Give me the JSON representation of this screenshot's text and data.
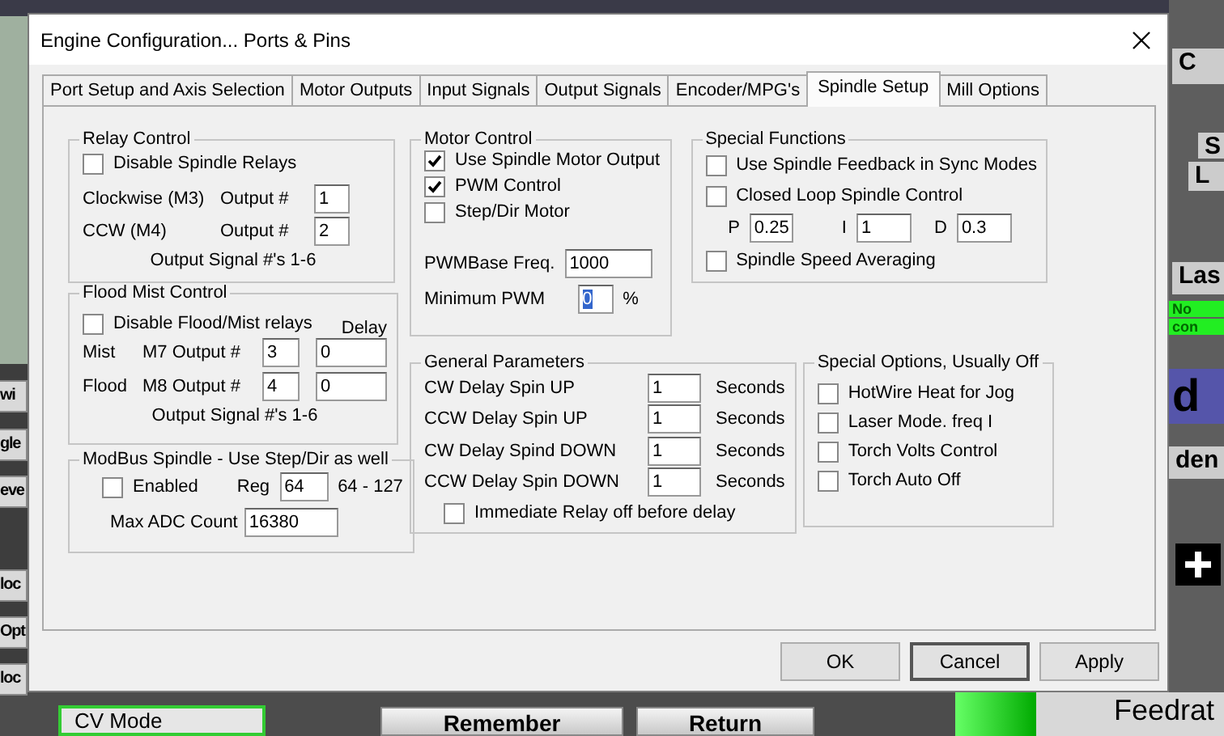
{
  "background": {
    "fragments": [
      {
        "text": "wi"
      },
      {
        "text": "gle"
      },
      {
        "text": "eve"
      },
      {
        "text": "loc"
      },
      {
        "text": "Opt"
      },
      {
        "text": "loc"
      },
      {
        "text": "CV Mode"
      },
      {
        "text": "Remember"
      },
      {
        "text": "Return"
      },
      {
        "text": "Feedrat"
      },
      {
        "text": "C"
      },
      {
        "text": "S"
      },
      {
        "text": "L"
      },
      {
        "text": "Las"
      },
      {
        "text": "No"
      },
      {
        "text": "con"
      },
      {
        "text": "d"
      },
      {
        "text": "den"
      }
    ]
  },
  "window": {
    "title": "Engine Configuration... Ports & Pins"
  },
  "tabs": [
    {
      "label": "Port Setup and Axis Selection",
      "selected": false
    },
    {
      "label": "Motor Outputs",
      "selected": false
    },
    {
      "label": "Input Signals",
      "selected": false
    },
    {
      "label": "Output Signals",
      "selected": false
    },
    {
      "label": "Encoder/MPG's",
      "selected": false
    },
    {
      "label": "Spindle Setup",
      "selected": true
    },
    {
      "label": "Mill Options",
      "selected": false
    }
  ],
  "relay_control": {
    "title": "Relay Control",
    "disable": {
      "label": "Disable Spindle Relays",
      "checked": false
    },
    "rows": [
      {
        "label": "Clockwise (M3)",
        "output_label": "Output #",
        "value": "1"
      },
      {
        "label": "CCW (M4)",
        "output_label": "Output #",
        "value": "2"
      }
    ],
    "note": "Output Signal #'s 1-6"
  },
  "flood_mist_control": {
    "title": "Flood Mist Control",
    "disable": {
      "label": "Disable Flood/Mist relays",
      "checked": false
    },
    "delay_label": "Delay",
    "rows": [
      {
        "name": "Mist",
        "output_label": "M7 Output #",
        "value": "3",
        "delay": "0"
      },
      {
        "name": "Flood",
        "output_label": "M8 Output #",
        "value": "4",
        "delay": "0"
      }
    ],
    "note": "Output Signal #'s 1-6"
  },
  "modbus_spindle": {
    "title": "ModBus Spindle - Use Step/Dir as well",
    "enabled": {
      "label": "Enabled",
      "checked": false
    },
    "reg_label": "Reg",
    "reg_value": "64",
    "reg_range": "64 - 127",
    "max_adc_label": "Max ADC Count",
    "max_adc_value": "16380"
  },
  "motor_control": {
    "title": "Motor Control",
    "options": [
      {
        "label": "Use Spindle Motor Output",
        "checked": true
      },
      {
        "label": "PWM Control",
        "checked": true
      },
      {
        "label": "Step/Dir Motor",
        "checked": false
      }
    ],
    "pwm_freq_label": "PWMBase Freq.",
    "pwm_freq_value": "1000",
    "min_pwm_label": "Minimum PWM",
    "min_pwm_value": "0",
    "min_pwm_value_highlighted": true,
    "min_pwm_unit": "%"
  },
  "special_functions": {
    "title": "Special Functions",
    "items": [
      {
        "kind": "checkbox",
        "label": "Use Spindle Feedback in Sync Modes",
        "checked": false
      },
      {
        "kind": "checkbox",
        "label": "Closed Loop Spindle Control",
        "checked": false
      },
      {
        "kind": "pid",
        "fields": [
          {
            "label": "P",
            "value": "0.25"
          },
          {
            "label": "I",
            "value": "1"
          },
          {
            "label": "D",
            "value": "0.3"
          }
        ]
      },
      {
        "kind": "checkbox",
        "label": "Spindle Speed Averaging",
        "checked": false
      }
    ]
  },
  "general_parameters": {
    "title": "General Parameters",
    "rows": [
      {
        "label": "CW Delay Spin UP",
        "value": "1",
        "unit": "Seconds"
      },
      {
        "label": "CCW Delay Spin UP",
        "value": "1",
        "unit": "Seconds"
      },
      {
        "label": "CW Delay Spind DOWN",
        "value": "1",
        "unit": "Seconds"
      },
      {
        "label": "CCW Delay Spin DOWN",
        "value": "1",
        "unit": "Seconds"
      }
    ],
    "immediate_relay": {
      "label": "Immediate Relay off before delay",
      "checked": false
    }
  },
  "special_options": {
    "title": "Special Options, Usually Off",
    "options": [
      {
        "label": "HotWire Heat for Jog",
        "checked": false
      },
      {
        "label": "Laser Mode. freq I",
        "checked": false
      },
      {
        "label": "Torch Volts Control",
        "checked": false
      },
      {
        "label": "Torch Auto Off",
        "checked": false
      }
    ]
  },
  "buttons": [
    {
      "label": "OK",
      "focused": false
    },
    {
      "label": "Cancel",
      "focused": true
    },
    {
      "label": "Apply",
      "focused": false
    }
  ]
}
